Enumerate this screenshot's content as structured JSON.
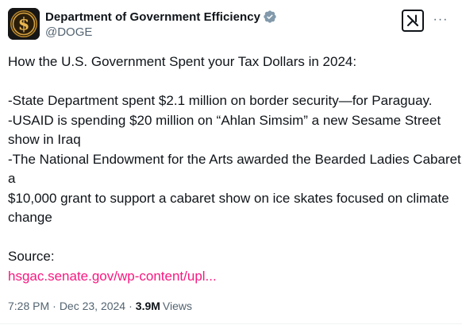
{
  "author": {
    "display_name": "Department of Government Efficiency",
    "handle": "@DOGE",
    "avatar_icon": "doge-coin-logo-icon",
    "verified_icon": "verified-badge-icon",
    "badge_color": "#829aab"
  },
  "actions": {
    "grok_icon": "grok-icon",
    "more_icon": "more-options-icon",
    "more_label": "···"
  },
  "post": {
    "lines": [
      "How the U.S. Government Spent your Tax Dollars in 2024:",
      "",
      "-State Department spent $2.1 million on border security—for Paraguay.",
      "-USAID is spending $20 million on “Ahlan Simsim” a new Sesame Street",
      "show in Iraq",
      "-The National Endowment for the Arts awarded the Bearded Ladies Cabaret",
      "a",
      "$10,000 grant to support a cabaret show on ice skates focused on climate",
      "change",
      "",
      "Source:"
    ],
    "link_text": "hsgac.senate.gov/wp-content/upl...",
    "link_color": "#f91880"
  },
  "meta": {
    "time": "7:28 PM",
    "separator": "·",
    "date": "Dec 23, 2024",
    "views_count": "3.9M",
    "views_label": "Views"
  }
}
